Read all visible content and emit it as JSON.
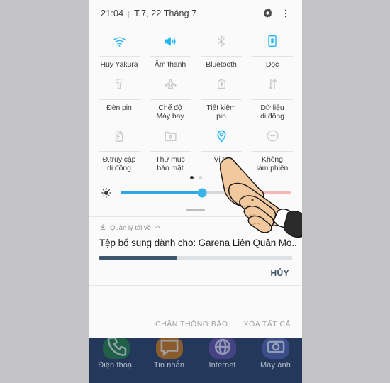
{
  "status": {
    "time": "21:04",
    "separator": "|",
    "date": "T.7, 22 Tháng 7",
    "settings_icon": "gear-icon",
    "overflow_icon": "more-vertical-icon"
  },
  "quick_settings": {
    "rows": [
      [
        {
          "label": "Huy Yakura",
          "icon": "wifi-icon",
          "active": true
        },
        {
          "label": "Âm thanh",
          "icon": "sound-icon",
          "active": true
        },
        {
          "label": "Bluetooth",
          "icon": "bluetooth-icon",
          "active": false
        },
        {
          "label": "Dọc",
          "icon": "rotation-lock-icon",
          "active": true
        }
      ],
      [
        {
          "label": "Đèn pin",
          "icon": "flashlight-icon",
          "active": false
        },
        {
          "label": "Chế độ\nMáy bay",
          "icon": "airplane-icon",
          "active": false
        },
        {
          "label": "Tiết kiệm\npin",
          "icon": "battery-saver-icon",
          "active": false
        },
        {
          "label": "Dữ liệu\ndi động",
          "icon": "mobile-data-icon",
          "active": false
        }
      ],
      [
        {
          "label": "Đ.truy cập\ndi động",
          "icon": "hotspot-icon",
          "active": false
        },
        {
          "label": "Thư mục\nbảo mật",
          "icon": "secure-folder-icon",
          "active": false
        },
        {
          "label": "Vị trí",
          "icon": "location-pin-icon",
          "active": true
        },
        {
          "label": "Không\nlàm phiền",
          "icon": "do-not-disturb-icon",
          "active": false
        }
      ]
    ],
    "page_dots": {
      "count": 2,
      "active_index": 0
    },
    "brightness": {
      "icon": "brightness-icon",
      "value_percent": 48
    },
    "accent_color": "#22b7f2",
    "inactive_color": "#c9cacc"
  },
  "notification": {
    "app_icon": "download-icon",
    "app_name": "Quản lý tải về",
    "collapse_icon": "chevron-up-icon",
    "title": "Tệp bổ sung dành cho: Garena Liên Quân Mo..",
    "progress_percent": 40,
    "progress_color": "#3d566e",
    "cancel_label": "HỦY"
  },
  "footer": {
    "block_label": "CHẶN THÔNG BÁO",
    "clear_all_label": "XÓA TẤT CẢ"
  },
  "dock": {
    "items": [
      {
        "label": "Điện thoại",
        "icon": "phone-icon",
        "color": "#1f7a3f"
      },
      {
        "label": "Tin nhắn",
        "icon": "message-icon",
        "color": "#c97112"
      },
      {
        "label": "Internet",
        "icon": "browser-icon",
        "color": "#5a4b9e"
      },
      {
        "label": "Máy ảnh",
        "icon": "camera-icon",
        "color": "#4a5aa8"
      }
    ]
  },
  "cursor": {
    "icon": "pointing-hand-cursor",
    "target": "Vị trí"
  }
}
